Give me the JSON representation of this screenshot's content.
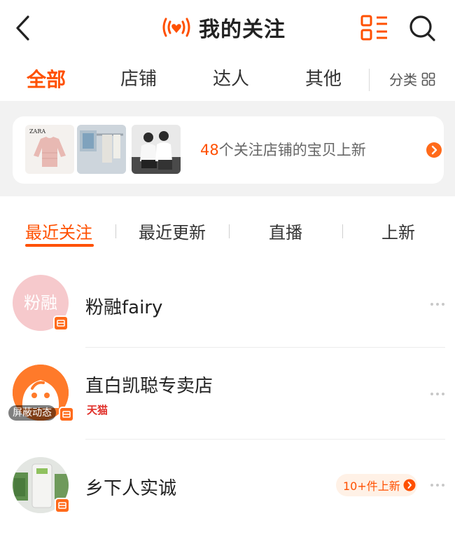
{
  "header": {
    "title": "我的关注"
  },
  "tabs": [
    {
      "label": "全部",
      "active": true
    },
    {
      "label": "店铺",
      "active": false
    },
    {
      "label": "达人",
      "active": false
    },
    {
      "label": "其他",
      "active": false
    }
  ],
  "category": {
    "label": "分类"
  },
  "promo": {
    "count": "48",
    "text": "个关注店铺的宝贝上新",
    "thumb_brand": "ZARA"
  },
  "subtabs": [
    {
      "label": "最近关注",
      "active": true
    },
    {
      "label": "最近更新",
      "active": false
    },
    {
      "label": "直播",
      "active": false
    },
    {
      "label": "上新",
      "active": false
    }
  ],
  "rows": [
    {
      "name": "粉融fairy",
      "avatar_text": "粉融"
    },
    {
      "name": "直白凯聪专卖店",
      "tag": "天猫",
      "overlay": "屏蔽动态"
    },
    {
      "name": "乡下人实诚",
      "new_label": "10+件上新"
    }
  ],
  "colors": {
    "accent": "#ff5000",
    "tmall": "#e0302a"
  },
  "icons": [
    "back-arrow-icon",
    "live-heart-icon",
    "grid-list-icon",
    "search-icon",
    "category-grid-icon",
    "arrow-right-circle-icon",
    "store-badge-icon",
    "more-dots-icon"
  ]
}
